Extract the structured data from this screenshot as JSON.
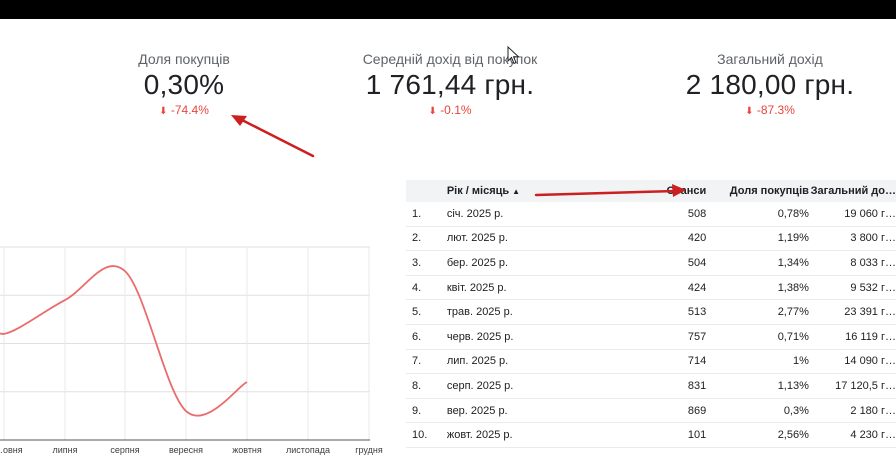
{
  "kpis": [
    {
      "label": "Доля покупців",
      "value": "0,30%",
      "delta": "-74.4%"
    },
    {
      "label": "Середній дохід від покупок",
      "value": "1 761,44 грн.",
      "delta": "-0.1%"
    },
    {
      "label": "Загальний дохід",
      "value": "2 180,00 грн.",
      "delta": "-87.3%"
    }
  ],
  "colors": {
    "negative": "#e8453c",
    "line": "#ea6c6c",
    "annotation_arrow": "#cc1f1f",
    "header_bg": "#f1f3f4"
  },
  "chart_data": {
    "type": "line",
    "x": [
      "…овня",
      "липня",
      "серпня",
      "вересня",
      "жовтня",
      "листопада",
      "грудня"
    ],
    "series": [
      {
        "values": [
          1.1,
          1.45,
          1.75,
          0.3,
          0.6,
          null,
          null
        ]
      }
    ],
    "grid": true
  },
  "table": {
    "columns": [
      "Рік / місяць",
      "Сеанси",
      "Доля покупців",
      "Загальний до…"
    ],
    "sort_indicator": "▲",
    "rows": [
      {
        "idx": "1.",
        "month": "січ. 2025 р.",
        "sessions": "508",
        "share": "0,78%",
        "revenue": "19 060 г…"
      },
      {
        "idx": "2.",
        "month": "лют. 2025 р.",
        "sessions": "420",
        "share": "1,19%",
        "revenue": "3 800 г…"
      },
      {
        "idx": "3.",
        "month": "бер. 2025 р.",
        "sessions": "504",
        "share": "1,34%",
        "revenue": "8 033 г…"
      },
      {
        "idx": "4.",
        "month": "квіт. 2025 р.",
        "sessions": "424",
        "share": "1,38%",
        "revenue": "9 532 г…"
      },
      {
        "idx": "5.",
        "month": "трав. 2025 р.",
        "sessions": "513",
        "share": "2,77%",
        "revenue": "23 391 г…"
      },
      {
        "idx": "6.",
        "month": "черв. 2025 р.",
        "sessions": "757",
        "share": "0,71%",
        "revenue": "16 119 г…"
      },
      {
        "idx": "7.",
        "month": "лип. 2025 р.",
        "sessions": "714",
        "share": "1%",
        "revenue": "14 090 г…"
      },
      {
        "idx": "8.",
        "month": "серп. 2025 р.",
        "sessions": "831",
        "share": "1,13%",
        "revenue": "17 120,5 г…"
      },
      {
        "idx": "9.",
        "month": "вер. 2025 р.",
        "sessions": "869",
        "share": "0,3%",
        "revenue": "2 180 г…"
      },
      {
        "idx": "10.",
        "month": "жовт. 2025 р.",
        "sessions": "101",
        "share": "2,56%",
        "revenue": "4 230 г…"
      }
    ]
  }
}
